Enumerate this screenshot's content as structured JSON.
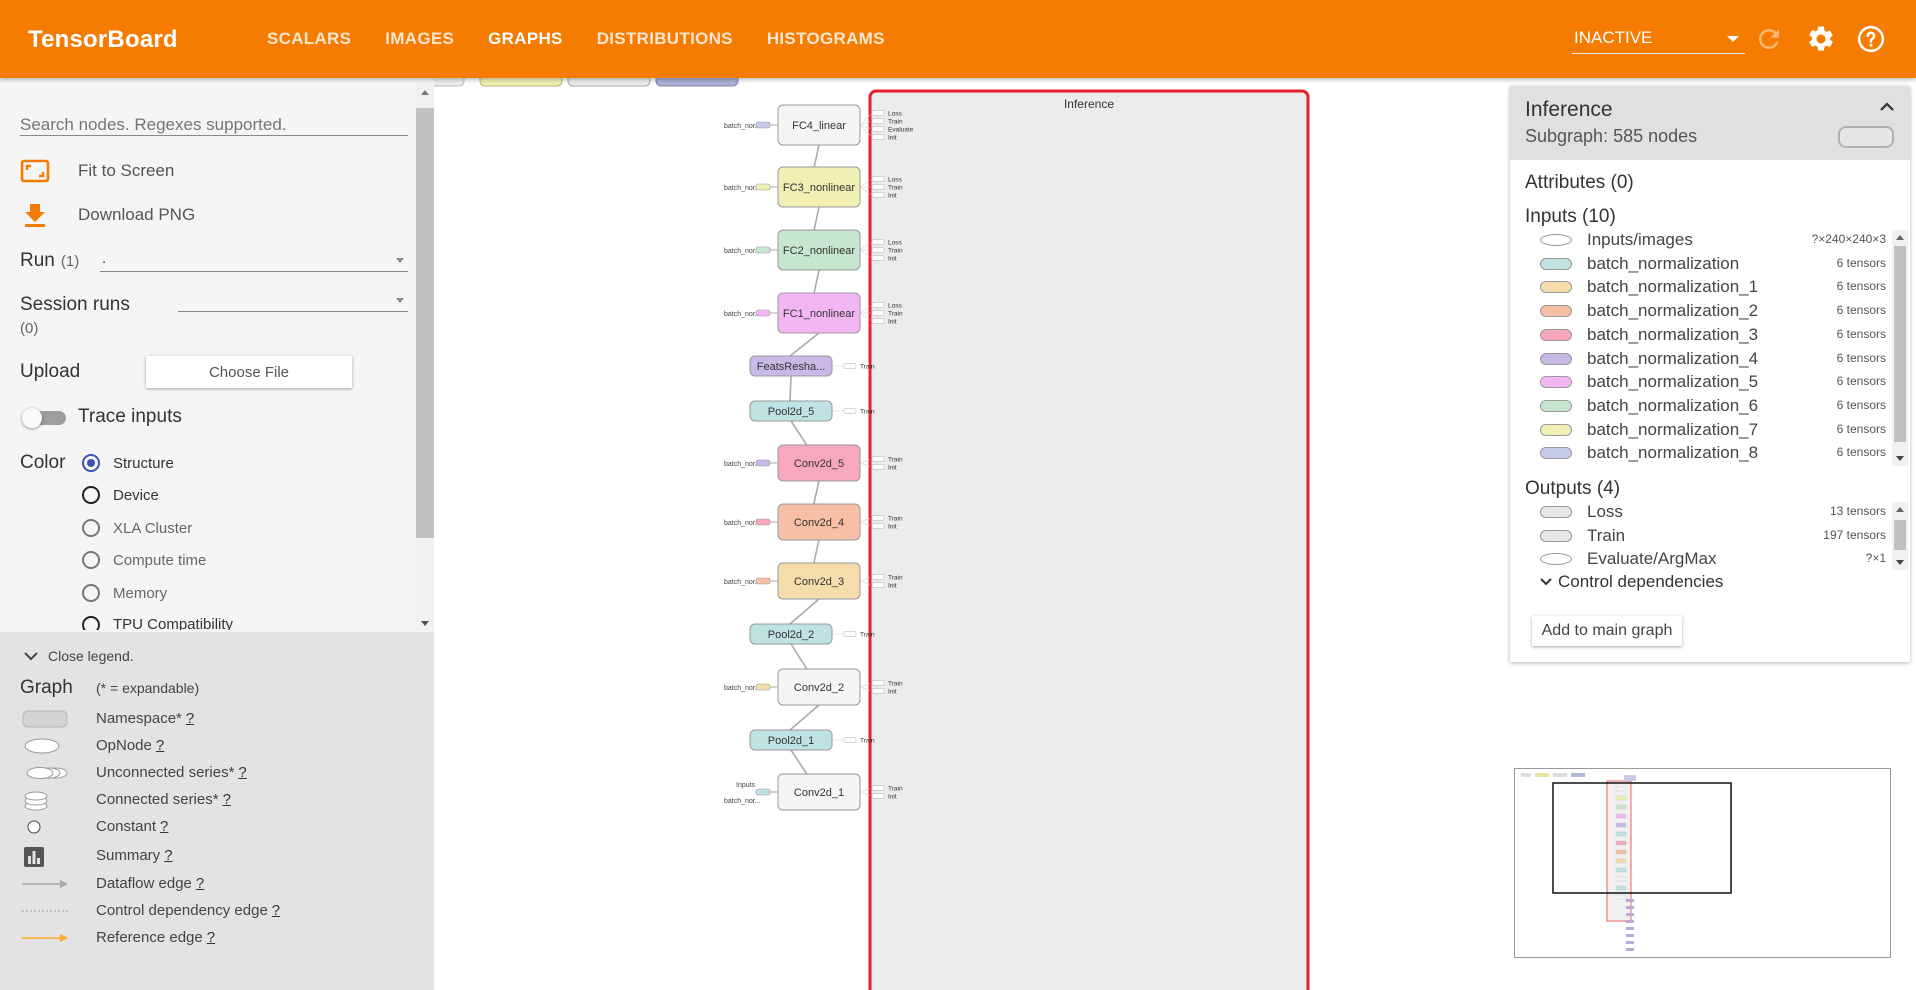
{
  "app": {
    "title": "TensorBoard",
    "tabs": [
      {
        "label": "SCALARS",
        "active": false
      },
      {
        "label": "IMAGES",
        "active": false
      },
      {
        "label": "GRAPHS",
        "active": true
      },
      {
        "label": "DISTRIBUTIONS",
        "active": false
      },
      {
        "label": "HISTOGRAMS",
        "active": false
      }
    ],
    "status_select": "INACTIVE",
    "colors": {
      "brand": "#f57c00",
      "accent": "#3f51b5",
      "highlight": "#e8202a"
    }
  },
  "sidebar": {
    "search_placeholder": "Search nodes. Regexes supported.",
    "fit_to_screen": "Fit to Screen",
    "download_png": "Download PNG",
    "run_label": "Run",
    "run_count": "(1)",
    "run_value": ".",
    "session_runs_label": "Session runs",
    "session_runs_count": "(0)",
    "upload_label": "Upload",
    "choose_file": "Choose File",
    "trace_inputs": "Trace inputs",
    "color_label": "Color",
    "color_options": [
      {
        "label": "Structure",
        "checked": true,
        "enabled": true
      },
      {
        "label": "Device",
        "checked": false,
        "enabled": true
      },
      {
        "label": "XLA Cluster",
        "checked": false,
        "enabled": false
      },
      {
        "label": "Compute time",
        "checked": false,
        "enabled": false
      },
      {
        "label": "Memory",
        "checked": false,
        "enabled": false
      },
      {
        "label": "TPU Compatibility",
        "checked": false,
        "enabled": true
      }
    ]
  },
  "legend": {
    "close_label": "Close legend.",
    "graph_label": "Graph",
    "expandable_note": "(* = expandable)",
    "help_mark": "?",
    "items": [
      {
        "label": "Namespace*",
        "icon": "namespace-icon"
      },
      {
        "label": "OpNode",
        "icon": "opnode-icon"
      },
      {
        "label": "Unconnected series*",
        "icon": "unconnected-series-icon"
      },
      {
        "label": "Connected series*",
        "icon": "connected-series-icon"
      },
      {
        "label": "Constant",
        "icon": "constant-icon"
      },
      {
        "label": "Summary",
        "icon": "summary-icon"
      },
      {
        "label": "Dataflow edge",
        "icon": "dataflow-edge-icon"
      },
      {
        "label": "Control dependency edge",
        "icon": "control-edge-icon"
      },
      {
        "label": "Reference edge",
        "icon": "reference-edge-icon"
      }
    ]
  },
  "graph": {
    "title": "Inference",
    "nodes": [
      {
        "name": "FC4_linear",
        "color": "#f5f5f5",
        "side_label": "batch_nor...",
        "side_color": "#c5cae9",
        "outs": [
          "Loss",
          "Train",
          "Evaluate",
          "Init"
        ]
      },
      {
        "name": "FC3_nonlinear",
        "color": "#f0f0b4",
        "side_label": "batch_nor...",
        "side_color": "#f0f0b4",
        "outs": [
          "Loss",
          "Train",
          "Init"
        ]
      },
      {
        "name": "FC2_nonlinear",
        "color": "#c6e6cf",
        "side_label": "batch_nor...",
        "side_color": "#c6e6cf",
        "outs": [
          "Loss",
          "Train",
          "Init"
        ]
      },
      {
        "name": "FC1_nonlinear",
        "color": "#f3b6f3",
        "side_label": "batch_nor...",
        "side_color": "#f3b6f3",
        "outs": [
          "Loss",
          "Train",
          "Init"
        ]
      },
      {
        "name": "FeatsResha...",
        "color": "#c9b9e6",
        "side_label": "",
        "side_color": "",
        "outs": [
          "Train"
        ]
      },
      {
        "name": "Pool2d_5",
        "color": "#bfe3e3",
        "side_label": "",
        "side_color": "",
        "outs": [
          "Train"
        ]
      },
      {
        "name": "Conv2d_5",
        "color": "#f7a8bd",
        "side_label": "batch_nor...",
        "side_color": "#c9b9e6",
        "outs": [
          "Train",
          "Init"
        ]
      },
      {
        "name": "Conv2d_4",
        "color": "#f7c0a6",
        "side_label": "batch_nor...",
        "side_color": "#f7a8bd",
        "outs": [
          "Train",
          "Init"
        ]
      },
      {
        "name": "Conv2d_3",
        "color": "#f5dcab",
        "side_label": "batch_nor...",
        "side_color": "#f7c0a6",
        "outs": [
          "Train",
          "Init"
        ]
      },
      {
        "name": "Pool2d_2",
        "color": "#bfe3e3",
        "side_label": "",
        "side_color": "",
        "outs": [
          "Train"
        ]
      },
      {
        "name": "Conv2d_2",
        "color": "#f5f5f5",
        "side_label": "batch_nor...",
        "side_color": "#f5dcab",
        "outs": [
          "Train",
          "Init"
        ]
      },
      {
        "name": "Pool2d_1",
        "color": "#bfe3e3",
        "side_label": "",
        "side_color": "",
        "outs": [
          "Train"
        ]
      },
      {
        "name": "Conv2d_1",
        "color": "#f5f5f5",
        "side_label": "Inputs",
        "side_label_2": "batch_nor...",
        "side_color": "#bfe3e3",
        "outs": [
          "Train",
          "Init"
        ]
      }
    ]
  },
  "info": {
    "title": "Inference",
    "subtitle": "Subgraph: 585 nodes",
    "attributes": "Attributes (0)",
    "inputs_title": "Inputs (10)",
    "inputs": [
      {
        "name": "Inputs/images",
        "count": "?×240×240×3",
        "color": "#ffffff",
        "op": true
      },
      {
        "name": "batch_normalization",
        "count": "6 tensors",
        "color": "#bfe3e3",
        "op": false
      },
      {
        "name": "batch_normalization_1",
        "count": "6 tensors",
        "color": "#f5dcab",
        "op": false
      },
      {
        "name": "batch_normalization_2",
        "count": "6 tensors",
        "color": "#f7c0a6",
        "op": false
      },
      {
        "name": "batch_normalization_3",
        "count": "6 tensors",
        "color": "#f7a8bd",
        "op": false
      },
      {
        "name": "batch_normalization_4",
        "count": "6 tensors",
        "color": "#c9b9e6",
        "op": false
      },
      {
        "name": "batch_normalization_5",
        "count": "6 tensors",
        "color": "#f3b6f3",
        "op": false
      },
      {
        "name": "batch_normalization_6",
        "count": "6 tensors",
        "color": "#c6e6cf",
        "op": false
      },
      {
        "name": "batch_normalization_7",
        "count": "6 tensors",
        "color": "#f0f0b4",
        "op": false
      },
      {
        "name": "batch_normalization_8",
        "count": "6 tensors",
        "color": "#c5cae9",
        "op": false
      }
    ],
    "outputs_title": "Outputs (4)",
    "outputs": [
      {
        "name": "Loss",
        "count": "13 tensors",
        "color": "#e8e8e8",
        "op": false
      },
      {
        "name": "Train",
        "count": "197 tensors",
        "color": "#e8e8e8",
        "op": false
      },
      {
        "name": "Evaluate/ArgMax",
        "count": "?×1",
        "color": "#ffffff",
        "op": true
      }
    ],
    "control_dependencies": "Control dependencies",
    "add_to_main": "Add to main graph"
  }
}
